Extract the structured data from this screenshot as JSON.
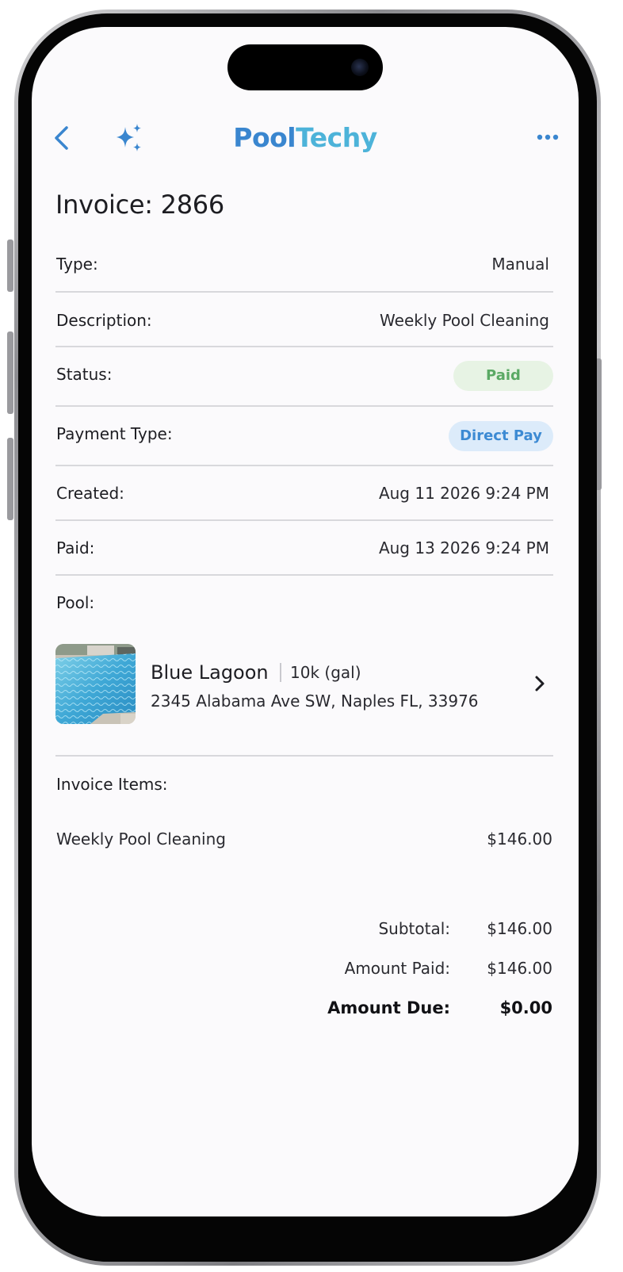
{
  "header": {
    "brand_first": "Pool",
    "brand_second": "Techy"
  },
  "invoice": {
    "title": "Invoice: 2866",
    "rows": [
      {
        "label": "Type:",
        "value": "Manual"
      },
      {
        "label": "Description:",
        "value": "Weekly Pool Cleaning"
      },
      {
        "label": "Status:",
        "value": "Paid"
      },
      {
        "label": "Payment Type:",
        "value": "Direct Pay"
      },
      {
        "label": "Created:",
        "value": "Aug 11 2026 9:24 PM"
      },
      {
        "label": "Paid:",
        "value": "Aug 13 2026 9:24 PM"
      }
    ]
  },
  "pool": {
    "label": "Pool:",
    "name": "Blue Lagoon",
    "volume": "10k (gal)",
    "address": "2345 Alabama Ave SW, Naples FL, 33976"
  },
  "items": {
    "label": "Invoice Items:",
    "list": [
      {
        "name": "Weekly Pool Cleaning",
        "amount": "$146.00"
      }
    ]
  },
  "totals": {
    "subtotal_label": "Subtotal:",
    "subtotal_value": "$146.00",
    "paid_label": "Amount Paid:",
    "paid_value": "$146.00",
    "due_label": "Amount Due:",
    "due_value": "$0.00"
  },
  "colors": {
    "accent": "#3a86cf",
    "paid_badge_bg": "#e7f3e4",
    "paid_badge_text": "#5aa964",
    "directpay_badge_bg": "#dcebfa",
    "directpay_badge_text": "#3c8ad3"
  },
  "icons": {
    "back": "chevron-left-icon",
    "assistant": "sparkles-icon",
    "more": "more-horizontal-icon",
    "pool_link": "chevron-right-icon"
  }
}
